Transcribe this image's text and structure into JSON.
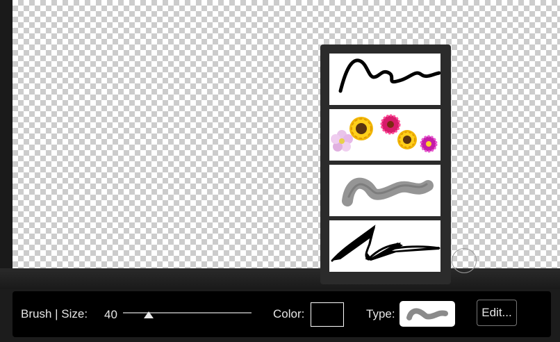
{
  "toolbar": {
    "brush_label": "Brush | Size:",
    "size_value": "40",
    "size_fraction": 0.2,
    "color_label": "Color:",
    "color_value": "#000000",
    "type_label": "Type:",
    "edit_label": "Edit..."
  },
  "brush_types": [
    {
      "name": "solid-stroke-brush",
      "selected": false
    },
    {
      "name": "flower-stamp-brush",
      "selected": false
    },
    {
      "name": "soft-gray-brush",
      "selected": true
    },
    {
      "name": "calligraphy-brush",
      "selected": false
    }
  ],
  "colors": {
    "background": "#1c1c1c",
    "panel": "#2b2b2b",
    "toolbar": "#000000",
    "text": "#e6e6e6",
    "checker": "#cccccc"
  }
}
